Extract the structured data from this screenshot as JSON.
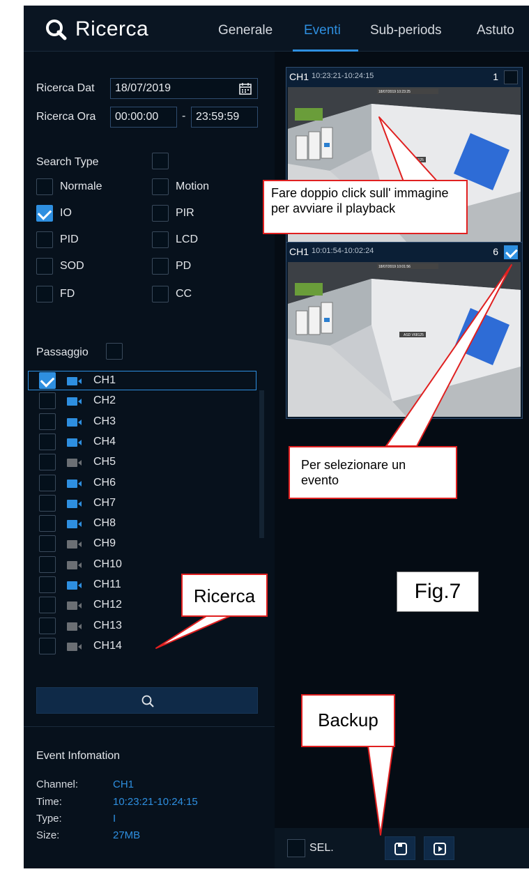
{
  "header": {
    "title": "Ricerca",
    "tabs": [
      {
        "label": "Generale",
        "active": false
      },
      {
        "label": "Eventi",
        "active": true
      },
      {
        "label": "Sub-periods",
        "active": false
      },
      {
        "label": "Astuto",
        "active": false
      }
    ]
  },
  "search": {
    "date_label": "Ricerca Dat",
    "date_value": "18/07/2019",
    "time_label": "Ricerca Ora",
    "time_start": "00:00:00",
    "time_sep": "-",
    "time_end": "23:59:59",
    "search_type_label": "Search Type",
    "types": [
      {
        "label": "Normale",
        "checked": false
      },
      {
        "label": "Motion",
        "checked": false
      },
      {
        "label": "IO",
        "checked": true
      },
      {
        "label": "PIR",
        "checked": false
      },
      {
        "label": "PID",
        "checked": false
      },
      {
        "label": "LCD",
        "checked": false
      },
      {
        "label": "SOD",
        "checked": false
      },
      {
        "label": "PD",
        "checked": false
      },
      {
        "label": "FD",
        "checked": false
      },
      {
        "label": "CC",
        "checked": false
      }
    ],
    "passaggio_label": "Passaggio"
  },
  "channels": [
    {
      "name": "CH1",
      "checked": true,
      "active": true
    },
    {
      "name": "CH2",
      "checked": false,
      "active": true
    },
    {
      "name": "CH3",
      "checked": false,
      "active": true
    },
    {
      "name": "CH4",
      "checked": false,
      "active": true
    },
    {
      "name": "CH5",
      "checked": false,
      "active": false
    },
    {
      "name": "CH6",
      "checked": false,
      "active": true
    },
    {
      "name": "CH7",
      "checked": false,
      "active": true
    },
    {
      "name": "CH8",
      "checked": false,
      "active": true
    },
    {
      "name": "CH9",
      "checked": false,
      "active": false
    },
    {
      "name": "CH10",
      "checked": false,
      "active": false
    },
    {
      "name": "CH11",
      "checked": false,
      "active": true
    },
    {
      "name": "CH12",
      "checked": false,
      "active": false
    },
    {
      "name": "CH13",
      "checked": false,
      "active": false
    },
    {
      "name": "CH14",
      "checked": false,
      "active": false
    }
  ],
  "event_info": {
    "title": "Event Infomation",
    "channel_label": "Channel:",
    "channel_value": "CH1",
    "time_label": "Time:",
    "time_value": "10:23:21-10:24:15",
    "type_label": "Type:",
    "type_value": "I",
    "size_label": "Size:",
    "size_value": "27MB"
  },
  "events": [
    {
      "channel": "CH1",
      "time": "10:23:21-10:24:15",
      "number": "1",
      "checked": false,
      "osd": "18/07/2019 10:23:25",
      "cam_id": "ASD V68125"
    },
    {
      "channel": "CH1",
      "time": "10:01:54-10:02:24",
      "number": "6",
      "checked": true,
      "osd": "18/07/2019 10:01:56",
      "cam_id": "ASD V68125"
    }
  ],
  "bottom": {
    "sel_label": "SEL."
  },
  "callouts": {
    "playback": "Fare doppio click sull' immagine per avviare il playback",
    "select_event": "Per selezionare un evento",
    "ricerca": "Ricerca",
    "backup": "Backup",
    "fig": "Fig.7"
  },
  "colors": {
    "accent": "#2e8fe0",
    "background": "#050c14",
    "callout_border": "#e02020",
    "inactive_camera": "#6b6f74"
  }
}
